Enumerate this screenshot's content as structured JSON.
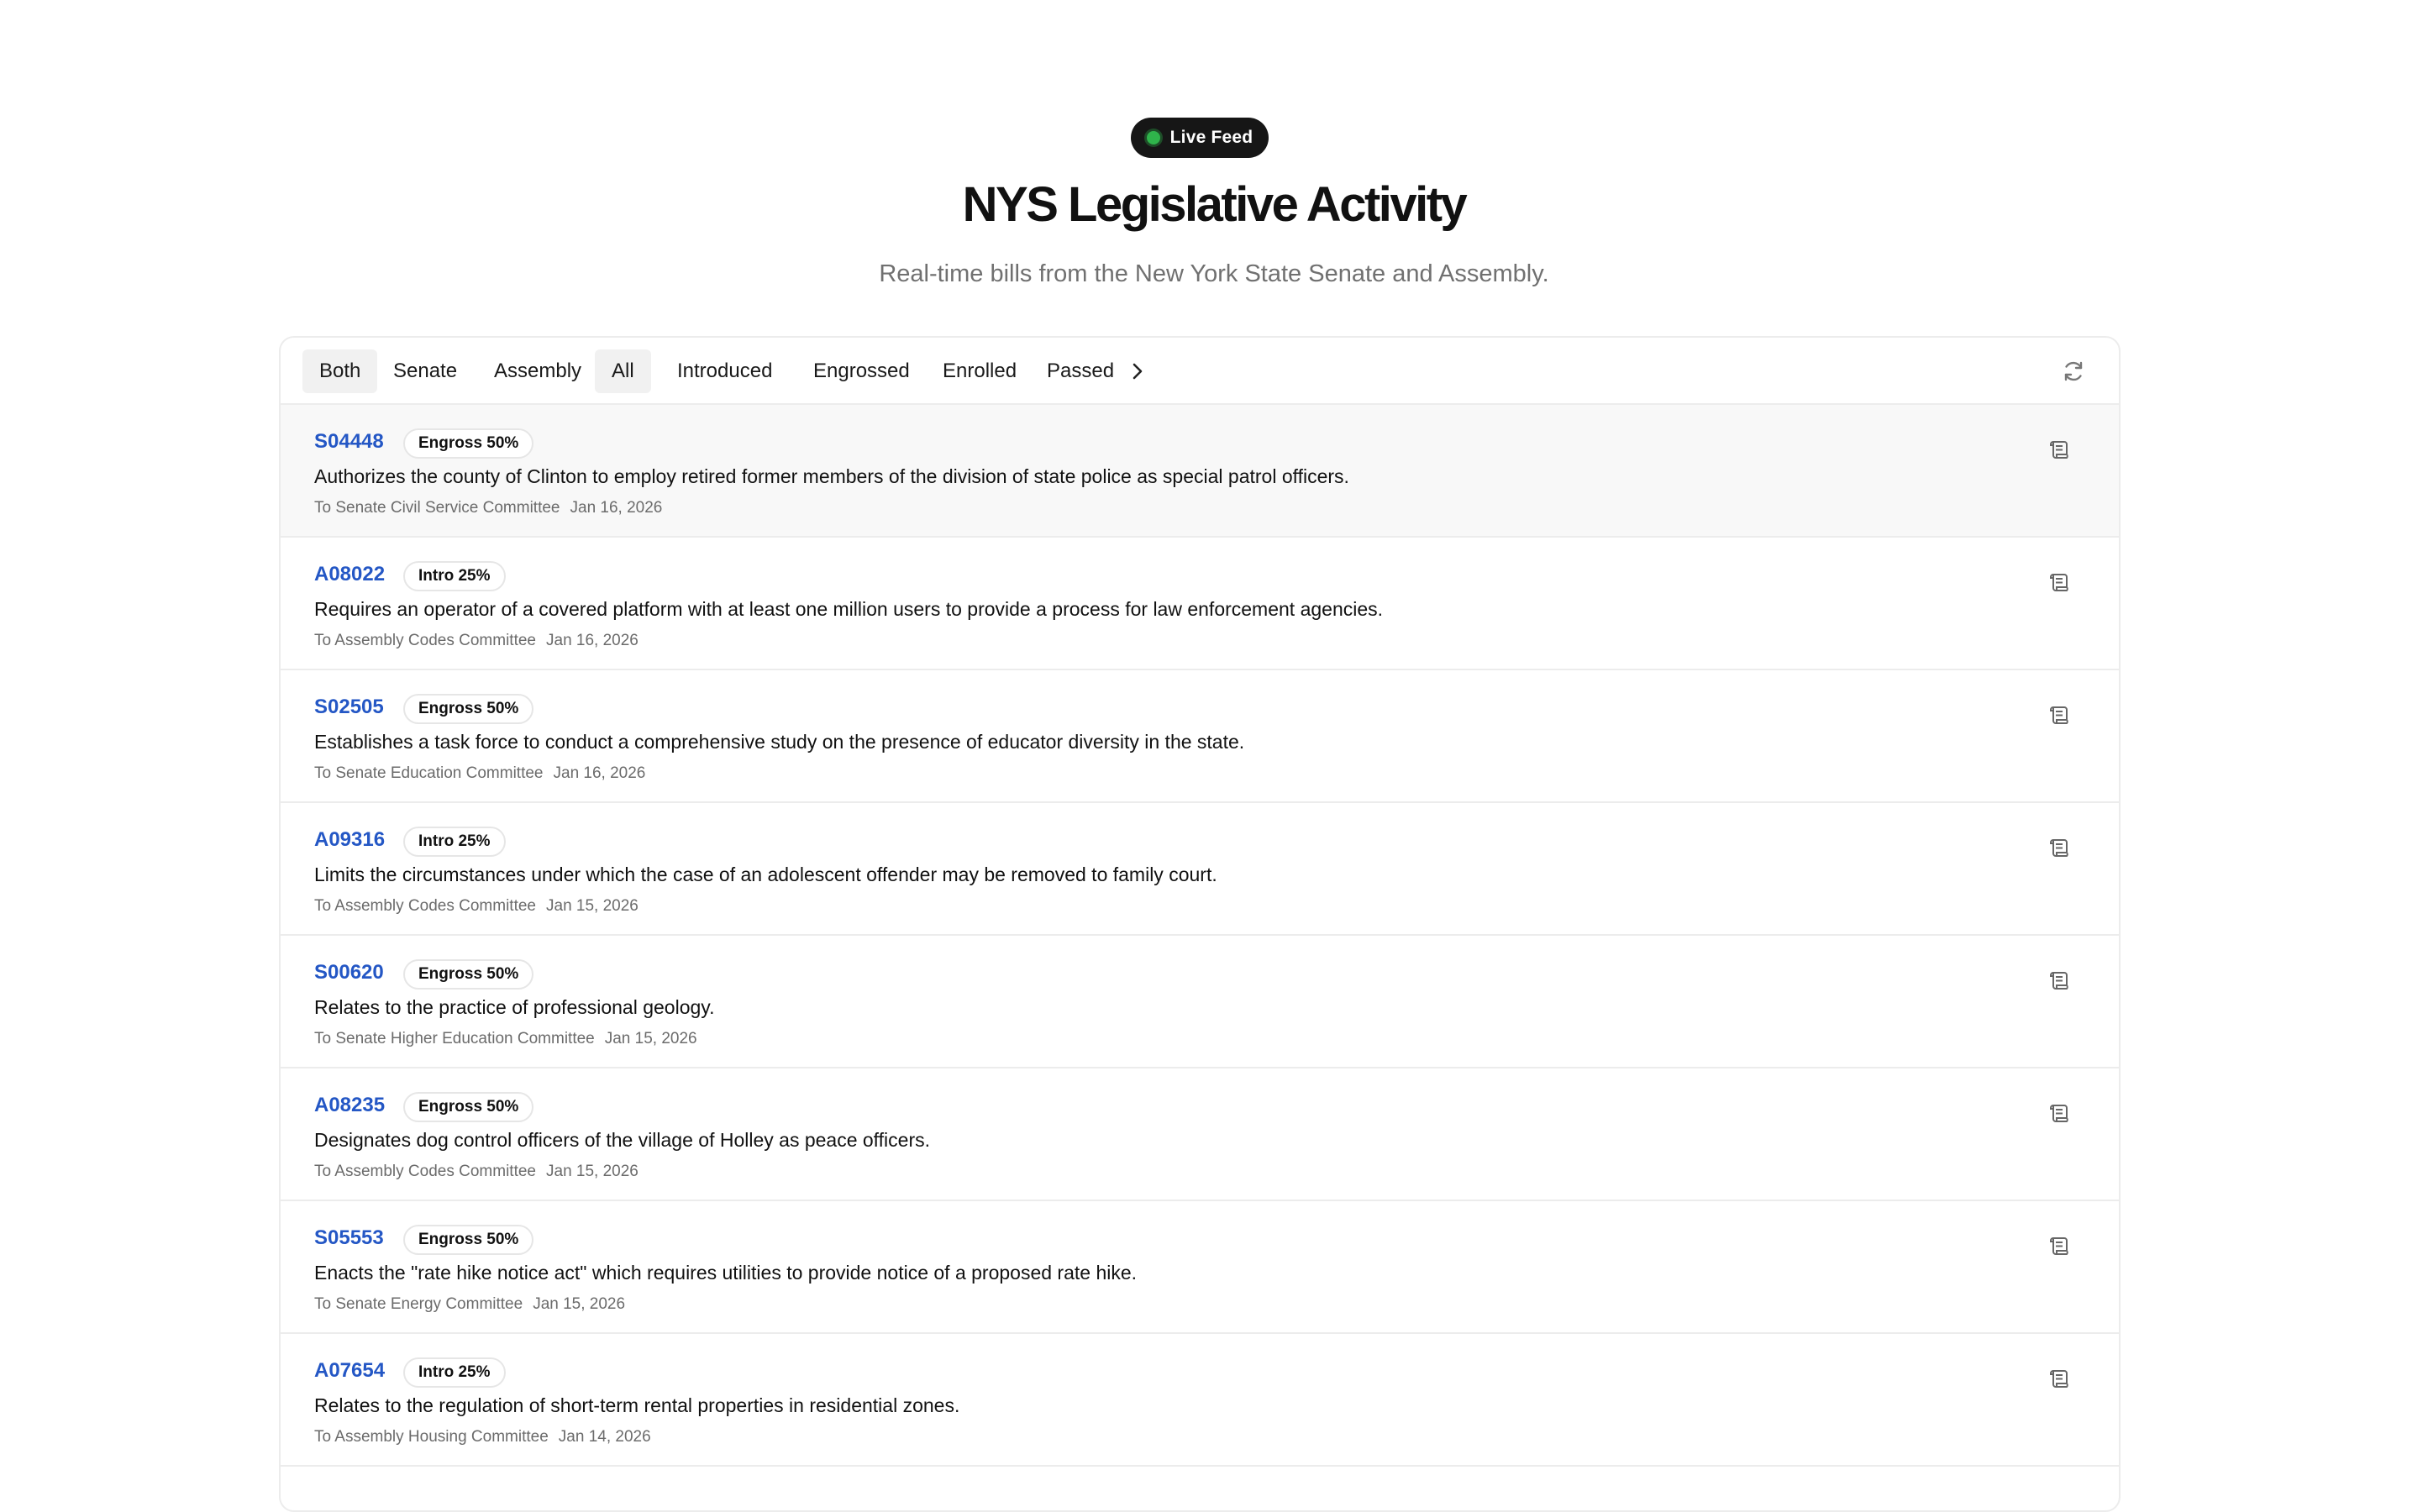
{
  "header": {
    "live_label": "Live Feed",
    "title": "NYS Legislative Activity",
    "subtitle": "Real-time bills from the New York State Senate and Assembly."
  },
  "filters": {
    "chambers": [
      "Both",
      "Senate",
      "Assembly"
    ],
    "statuses": [
      "All",
      "Introduced",
      "Engrossed",
      "Enrolled",
      "Passed"
    ],
    "active_chamber": "Both",
    "active_status": "All"
  },
  "icons": {
    "more": "chevron-right-icon",
    "refresh": "refresh-icon",
    "bill_doc": "scroll-document-icon"
  },
  "colors": {
    "accent_link": "#2457c5",
    "live_dot": "#2fb44b",
    "badge_bg": "#161616"
  },
  "bills": [
    {
      "id": "S04448",
      "stage": "Engross 50%",
      "progress": 0.5,
      "description": "Authorizes the county of Clinton to employ retired former members of the division of state police as special patrol officers.",
      "committee": "To Senate Civil Service Committee",
      "date": "Jan 16, 2026"
    },
    {
      "id": "A08022",
      "stage": "Intro 25%",
      "progress": 0.25,
      "description": "Requires an operator of a covered platform with at least one million users to provide a process for law enforcement agencies.",
      "committee": "To Assembly Codes Committee",
      "date": "Jan 16, 2026"
    },
    {
      "id": "S02505",
      "stage": "Engross 50%",
      "progress": 0.5,
      "description": "Establishes a task force to conduct a comprehensive study on the presence of educator diversity in the state.",
      "committee": "To Senate Education Committee",
      "date": "Jan 16, 2026"
    },
    {
      "id": "A09316",
      "stage": "Intro 25%",
      "progress": 0.25,
      "description": "Limits the circumstances under which the case of an adolescent offender may be removed to family court.",
      "committee": "To Assembly Codes Committee",
      "date": "Jan 15, 2026"
    },
    {
      "id": "S00620",
      "stage": "Engross 50%",
      "progress": 0.5,
      "description": "Relates to the practice of professional geology.",
      "committee": "To Senate Higher Education Committee",
      "date": "Jan 15, 2026"
    },
    {
      "id": "A08235",
      "stage": "Engross 50%",
      "progress": 0.5,
      "description": "Designates dog control officers of the village of Holley as peace officers.",
      "committee": "To Assembly Codes Committee",
      "date": "Jan 15, 2026"
    },
    {
      "id": "S05553",
      "stage": "Engross 50%",
      "progress": 0.5,
      "description": "Enacts the \"rate hike notice act\" which requires utilities to provide notice of a proposed rate hike.",
      "committee": "To Senate Energy Committee",
      "date": "Jan 15, 2026"
    },
    {
      "id": "A07654",
      "stage": "Intro 25%",
      "progress": 0.25,
      "description": "Relates to the regulation of short-term rental properties in residential zones.",
      "committee": "To Assembly Housing Committee",
      "date": "Jan 14, 2026"
    }
  ]
}
